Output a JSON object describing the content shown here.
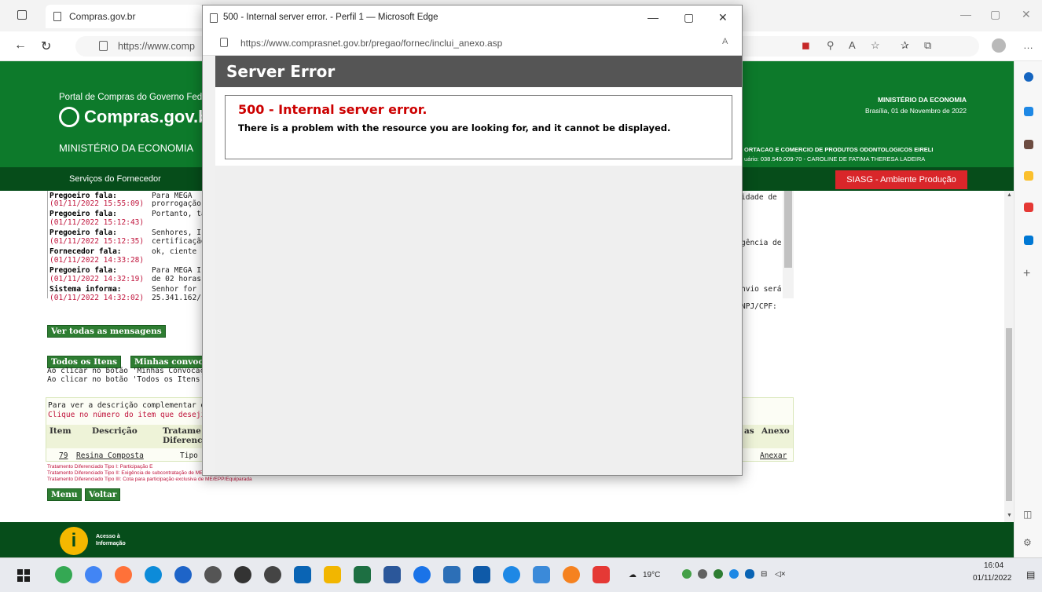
{
  "browser": {
    "tab_title": "Compras.gov.br",
    "url": "https://www.comp"
  },
  "header": {
    "portal_title": "Portal de Compras do Governo Fed",
    "logo_text": "Compras.gov.br",
    "ministerio": "MINISTÉRIO DA ECONOMIA",
    "ministerio_right": "MINISTÉRIO DA ECONOMIA",
    "data": "Brasília, 01 de Novembro de 2022",
    "empresa": "ORTACAO E COMERCIO DE PRODUTOS ODONTOLOGICOS EIRELI",
    "usuario": "uário: 038.549.009-70 - CAROLINE DE FATIMA THERESA LADEIRA",
    "menu_item": "Serviços do Fornecedor",
    "ambiente": "SIASG - Ambiente Produção"
  },
  "messages": [
    {
      "who": "Pregoeiro fala:",
      "ts": "",
      "text": "Para MEGA"
    },
    {
      "who": "",
      "ts": "(01/11/2022 15:55:09)",
      "text": "prorrogação"
    },
    {
      "who": "Pregoeiro fala:",
      "ts": "",
      "text": "Portanto, tal"
    },
    {
      "who": "",
      "ts": "(01/11/2022 15:12:43)",
      "text": ""
    },
    {
      "who": "Pregoeiro fala:",
      "ts": "",
      "text": "Senhores, I"
    },
    {
      "who": "",
      "ts": "(01/11/2022 15:12:35)",
      "text": "certificação"
    },
    {
      "who": "Fornecedor fala:",
      "ts": "",
      "text": "ok, ciente !"
    },
    {
      "who": "",
      "ts": "(01/11/2022 14:33:28)",
      "text": ""
    },
    {
      "who": "Pregoeiro fala:",
      "ts": "",
      "text": "Para MEGA I"
    },
    {
      "who": "",
      "ts": "(01/11/2022 14:32:19)",
      "text": "de 02 horas."
    },
    {
      "who": "Sistema informa:",
      "ts": "",
      "text": "Senhor  for"
    },
    {
      "who": "",
      "ts": "(01/11/2022 14:32:02)",
      "text": "25.341.162/"
    }
  ],
  "messages_right": [
    "idade de",
    "gência de",
    "nvio será",
    "NPJ/CPF:"
  ],
  "buttons": {
    "ver_todas": "Ver todas as mensagens",
    "todos_itens": "Todos os Itens",
    "minhas_conv": "Minhas convoc",
    "menu": "Menu",
    "voltar": "Voltar"
  },
  "info_lines": [
    "Ao clicar no botão 'Minhas Convocaçõ",
    "Ao clicar no botão 'Todos os Itens' se"
  ],
  "table": {
    "note1": "Para ver a descrição complementar d",
    "note2": "Clique no número do item que deseji",
    "headers": {
      "item": "Item",
      "descricao": "Descrição",
      "tratamento": "Tratame",
      "diferenciado": "Diferenci",
      "respostas": "as",
      "anexo": "Anexo"
    },
    "row": {
      "item": "79",
      "descricao": "Resina Composta",
      "tratamento": "Tipo I",
      "anexo": "Anexar"
    }
  },
  "legend": [
    "Tratamento Diferenciado Tipo I: Participação E",
    "Tratamento Diferenciado Tipo II: Exigência de subcontratação de ME/EPP/Equiparada",
    "Tratamento Diferenciado Tipo III: Cota para participação exclusiva de ME/EPP/Equiparada"
  ],
  "footer": {
    "acesso_1": "Acesso à",
    "acesso_2": "Informação"
  },
  "popup": {
    "title": "500 - Internal server error. - Perfil 1 — Microsoft Edge",
    "url": "https://www.comprasnet.gov.br/pregao/fornec/inclui_anexo.asp",
    "server_error": "Server Error",
    "error_title": "500 - Internal server error.",
    "error_text": "There is a problem with the resource you are looking for, and it cannot be displayed."
  },
  "taskbar": {
    "temperature": "19°C",
    "time": "16:04",
    "date": "01/11/2022"
  },
  "colors": {
    "gov_green": "#0d7a2b",
    "gov_dark_green": "#064d1a",
    "siasg_red": "#d9262a",
    "error_red": "#cc0000",
    "timestamp_red": "#c0143c"
  }
}
